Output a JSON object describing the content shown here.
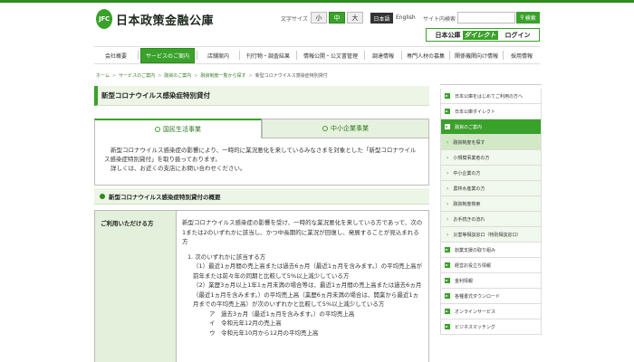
{
  "header": {
    "logo_mark": "JFC",
    "logo_text": "日本政策金融公庫",
    "font_size_label": "文字サイズ",
    "font_sizes": [
      "小",
      "中",
      "大"
    ],
    "lang_jp": "日本語",
    "lang_en": "English",
    "site_search_label": "サイト内検索",
    "search_button": "検索",
    "direct_jfc": "日本公庫",
    "direct_label": "ダイレクト",
    "direct_login": "ログイン"
  },
  "nav": {
    "items": [
      "会社概要",
      "サービスのご案内",
      "店舗案内",
      "刊行物・調査結果",
      "情報公開・公文書管理",
      "調達情報",
      "専門人材の募集",
      "関係機関向け情報",
      "採用情報"
    ]
  },
  "breadcrumb": [
    "ホーム",
    "サービスのご案内",
    "融資のご案内",
    "融資制度一覧から探す",
    "新型コロナウイルス感染症特別貸付"
  ],
  "main": {
    "title": "新型コロナウイルス感染症特別貸付",
    "tabs": [
      "国民生活事業",
      "中小企業事業"
    ],
    "intro": "新型コロナウイルス感染症の影響により、一時的に業況悪化を来しているみなさまを対象とした「新型コロナウイルス感染症特別貸付」を取り扱っております。",
    "intro2": "詳しくは、お近くの支店にお問い合わせください。",
    "section_title": "新型コロナウイルス感染症特別貸付の概要",
    "row_label": "ご利用いただける方",
    "row_lines": [
      "新型コロナウイルス感染症の影響を受け、一時的な業況悪化を来している方であって、次の1または2のいずれかに該当し、かつ中長期的に業況が回復し、発展することが見込まれる方",
      "1. 次のいずれかに該当する方",
      "（1）最近1ヵ月間の売上高または過去6ヵ月（最近1ヵ月を含みます。）の平均売上高が前年または前々年の同期と比較して5%以上減少している方",
      "（2）業歴3ヵ月以上1年1ヵ月未満の場合等は、最近1ヵ月間の売上高または過去6ヵ月（最近1ヵ月を含みます。）の平均売上高（業歴6ヵ月未満の場合は、開業から最近1ヵ月までの平均売上高）が次のいずれかと比較して5%以上減少している方",
      "ア　過去3ヵ月（最近1ヵ月を含みます。）の平均売上高",
      "イ　令和元年12月の売上高",
      "ウ　令和元年10月から12月の平均売上高"
    ]
  },
  "sidebar": {
    "items": [
      "日本公庫をはじめてご利用の方へ",
      "日本公庫ダイレクト",
      "融資のご案内",
      "融資制度を探す",
      "小規模事業者の方",
      "中小企業の方",
      "農林水産業の方",
      "融資制度検索",
      "お手続きの流れ",
      "災害等相談窓口（特別相談窓口）",
      "創業支援の取り組み",
      "経営お役立ち情報",
      "金利情報",
      "各種書式ダウンロード",
      "オンラインサービス",
      "ビジネスマッチング"
    ]
  }
}
